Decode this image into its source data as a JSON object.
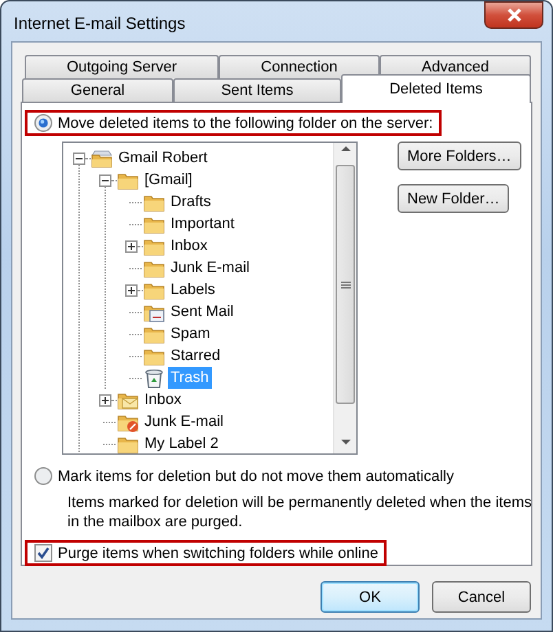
{
  "window": {
    "title": "Internet E-mail Settings"
  },
  "tab_rows": [
    [
      {
        "label": "Outgoing Server",
        "selected": false
      },
      {
        "label": "Connection",
        "selected": false
      },
      {
        "label": "Advanced",
        "selected": false
      }
    ],
    [
      {
        "label": "General",
        "selected": false
      },
      {
        "label": "Sent Items",
        "selected": false
      },
      {
        "label": "Deleted Items",
        "selected": true
      }
    ]
  ],
  "delete_options": [
    {
      "label": "Move deleted items to the following folder on the server:",
      "selected": true,
      "highlighted": true
    },
    {
      "label": "Mark items for deletion but do not move them automatically",
      "selected": false,
      "highlighted": false
    }
  ],
  "folder_tree": {
    "items": [
      {
        "label": "Gmail Robert",
        "kind": "account",
        "selected": false,
        "expanded": true,
        "children": [
          {
            "label": "[Gmail]",
            "kind": "folder",
            "selected": false,
            "expanded": true,
            "children": [
              {
                "label": "Drafts",
                "kind": "folder",
                "selected": false
              },
              {
                "label": "Important",
                "kind": "folder",
                "selected": false
              },
              {
                "label": "Inbox",
                "kind": "folder",
                "selected": false,
                "expanded": false
              },
              {
                "label": "Junk E-mail",
                "kind": "folder",
                "selected": false
              },
              {
                "label": "Labels",
                "kind": "folder",
                "selected": false,
                "expanded": false
              },
              {
                "label": "Sent Mail",
                "kind": "sent",
                "selected": false
              },
              {
                "label": "Spam",
                "kind": "folder",
                "selected": false
              },
              {
                "label": "Starred",
                "kind": "folder",
                "selected": false
              },
              {
                "label": "Trash",
                "kind": "trash",
                "selected": true
              }
            ]
          },
          {
            "label": "Inbox",
            "kind": "mail",
            "selected": false,
            "expanded": false
          },
          {
            "label": "Junk E-mail",
            "kind": "junk",
            "selected": false
          },
          {
            "label": "My Label 2",
            "kind": "folder",
            "selected": false
          }
        ]
      }
    ]
  },
  "folder_buttons": [
    "More Folders…",
    "New Folder…"
  ],
  "note": "Items marked for deletion will be permanently deleted when the items in the mailbox are purged.",
  "purge_checkbox": {
    "label": "Purge items when switching folders while online",
    "checked": true,
    "highlighted": true
  },
  "buttons": [
    {
      "label": "OK",
      "default": true
    },
    {
      "label": "Cancel",
      "default": false
    }
  ]
}
